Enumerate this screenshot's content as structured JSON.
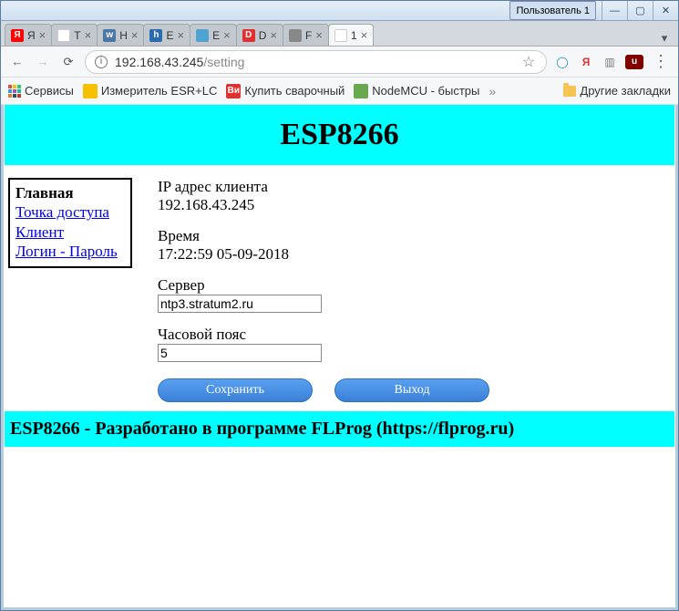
{
  "titlebar": {
    "user_badge": "Пользователь 1"
  },
  "tabs": [
    {
      "label": "Я",
      "fav_bg": "#ff0000",
      "fav_text": "Я"
    },
    {
      "label": "Т",
      "fav_bg": "#ffffff",
      "fav_text": ""
    },
    {
      "label": "Н",
      "fav_bg": "#4a76a8",
      "fav_text": "w"
    },
    {
      "label": "Е",
      "fav_bg": "#2b6cb0",
      "fav_text": "h"
    },
    {
      "label": "E",
      "fav_bg": "#4fa3d1",
      "fav_text": ""
    },
    {
      "label": "D",
      "fav_bg": "#e03131",
      "fav_text": "D"
    },
    {
      "label": "F",
      "fav_bg": "#888",
      "fav_text": ""
    },
    {
      "label": "1",
      "fav_bg": "#ffffff",
      "fav_text": ""
    }
  ],
  "address": {
    "host": "192.168.43.245",
    "path": "/setting"
  },
  "bookmarks": {
    "services": "Сервисы",
    "items": [
      {
        "label": "Измеритель ESR+LC",
        "icon_bg": "#f5c100",
        "icon_text": ""
      },
      {
        "label": "Купить сварочный",
        "icon_bg": "#e03131",
        "icon_text": "Ви"
      },
      {
        "label": "NodeMCU - быстры",
        "icon_bg": "#6aa84f",
        "icon_text": ""
      }
    ],
    "other": "Другие закладки"
  },
  "page": {
    "title": "ESP8266",
    "nav": {
      "home": "Главная",
      "ap": "Точка доступа",
      "client": "Клиент",
      "login": "Логин - Пароль"
    },
    "ip_label": "IP адрес клиента",
    "ip_value": "192.168.43.245",
    "time_label": "Время",
    "time_value": "17:22:59 05-09-2018",
    "server_label": "Сервер",
    "server_value": "ntp3.stratum2.ru",
    "tz_label": "Часовой пояс",
    "tz_value": "5",
    "save_btn": "Сохранить",
    "exit_btn": "Выход",
    "footer": "ESP8266 - Разработано в программе FLProg (https://flprog.ru)"
  }
}
